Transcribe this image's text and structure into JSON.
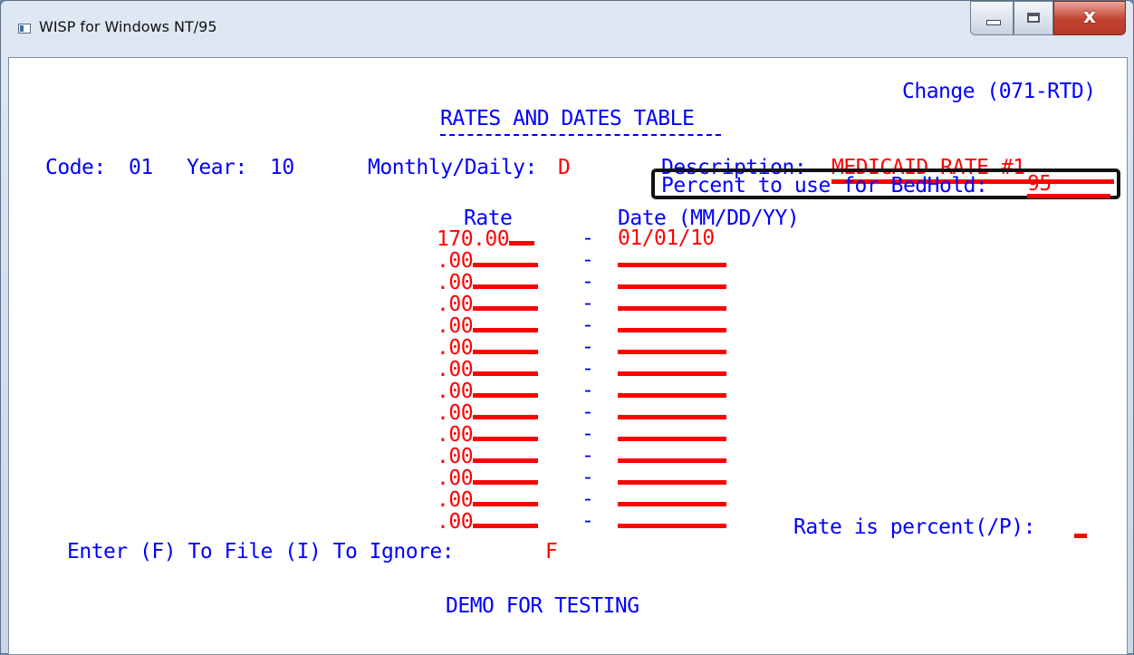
{
  "window": {
    "title": "WISP for Windows NT/95"
  },
  "screen": {
    "mode": "Change (071-RTD)",
    "heading": "RATES AND DATES TABLE",
    "code_label": "Code:",
    "code_value": "01",
    "year_label": "Year:",
    "year_value": "10",
    "monthly_daily_label": "Monthly/Daily:",
    "monthly_daily_value": "D",
    "description_label": "Description:",
    "description_value": "MEDICAID RATE #1",
    "bedhold_label": "Percent to use for BedHold:",
    "bedhold_value": "95",
    "rate_header": "Rate",
    "date_header": "Date (MM/DD/YY)",
    "separator": "-",
    "rows": [
      {
        "rate": "170.00",
        "date": "01/01/10"
      },
      {
        "rate": ".00",
        "date": ""
      },
      {
        "rate": ".00",
        "date": ""
      },
      {
        "rate": ".00",
        "date": ""
      },
      {
        "rate": ".00",
        "date": ""
      },
      {
        "rate": ".00",
        "date": ""
      },
      {
        "rate": ".00",
        "date": ""
      },
      {
        "rate": ".00",
        "date": ""
      },
      {
        "rate": ".00",
        "date": ""
      },
      {
        "rate": ".00",
        "date": ""
      },
      {
        "rate": ".00",
        "date": ""
      },
      {
        "rate": ".00",
        "date": ""
      },
      {
        "rate": ".00",
        "date": ""
      },
      {
        "rate": ".00",
        "date": ""
      }
    ],
    "rate_percent_label": "Rate is percent(/P):",
    "rate_percent_value": "",
    "enter_prompt": "Enter (F) To File (I) To Ignore:",
    "enter_value": "F",
    "footer": "DEMO FOR TESTING"
  },
  "colors": {
    "label": "#0000ff",
    "field": "#ff0000"
  }
}
